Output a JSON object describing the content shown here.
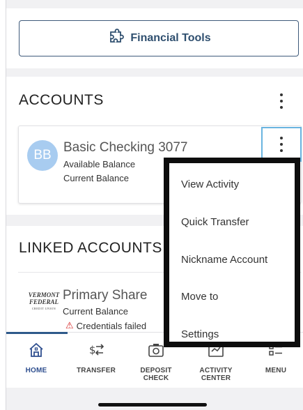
{
  "financial_tools": {
    "label": "Financial Tools",
    "icon": "puzzle-icon"
  },
  "accounts": {
    "title": "ACCOUNTS",
    "items": [
      {
        "initials": "BB",
        "name": "Basic Checking 3077",
        "available_label": "Available Balance",
        "current_label": "Current Balance"
      }
    ]
  },
  "linked_accounts": {
    "title": "LINKED ACCOUNTS",
    "items": [
      {
        "logo_text": "VERMONT FEDERAL",
        "logo_sub": "CREDIT UNION",
        "name": "Primary Share",
        "current_label": "Current Balance",
        "status": "Credentials failed"
      }
    ]
  },
  "context_menu": {
    "items": [
      "View Activity",
      "Quick Transfer",
      "Nickname Account",
      "Move to",
      "Settings"
    ]
  },
  "tabbar": {
    "tabs": [
      {
        "label": "HOME",
        "icon": "home-icon"
      },
      {
        "label": "TRANSFER",
        "icon": "transfer-icon"
      },
      {
        "label": "DEPOSIT\nCHECK",
        "icon": "camera-icon"
      },
      {
        "label": "ACTIVITY\nCENTER",
        "icon": "activity-icon"
      },
      {
        "label": "MENU",
        "icon": "menu-icon"
      }
    ]
  },
  "colors": {
    "accent": "#2f4f8f",
    "avatar": "#a8ccf0",
    "warning": "#d62828",
    "focus": "#6ab4e0"
  }
}
